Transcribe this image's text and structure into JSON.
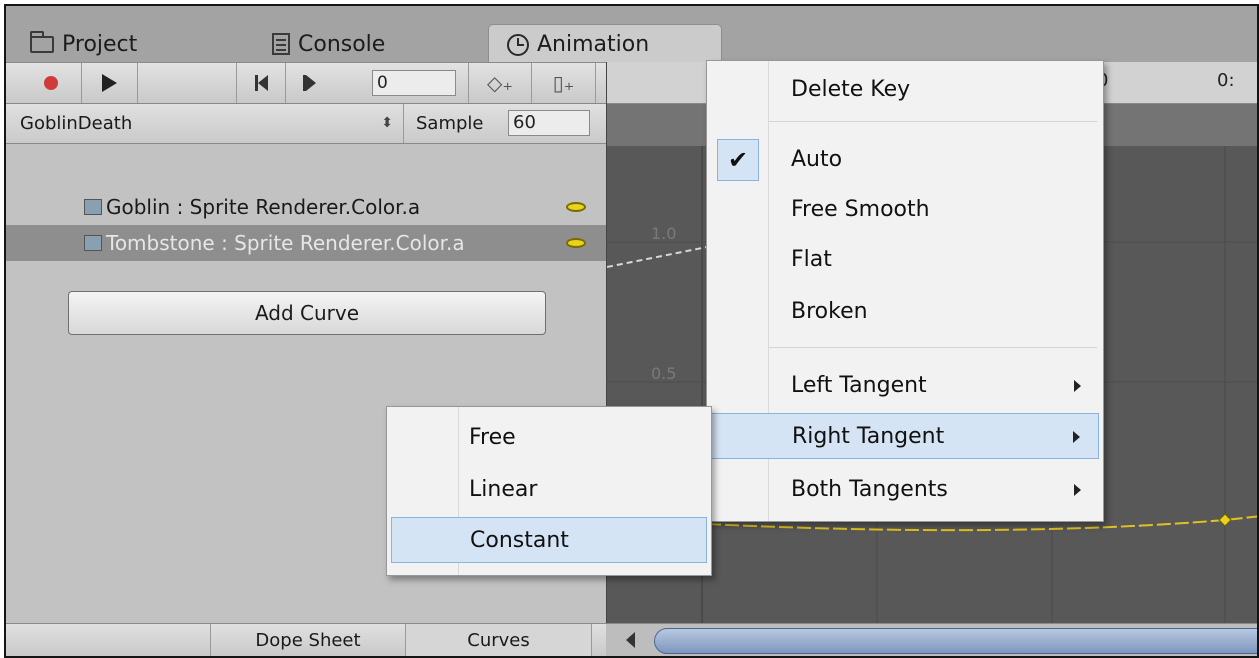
{
  "tabs": {
    "project": "Project",
    "console": "Console",
    "animation": "Animation"
  },
  "toolbar": {
    "frame_value": "0",
    "icons": [
      "record-icon",
      "play-icon",
      "prev-key-icon",
      "next-key-icon",
      "add-keyframe-icon",
      "add-event-icon"
    ]
  },
  "clip": {
    "name": "GoblinDeath",
    "sample_label": "Sample",
    "sample_value": "60"
  },
  "properties": [
    {
      "label": "Goblin : Sprite Renderer.Color.a"
    },
    {
      "label": "Tombstone : Sprite Renderer.Color.a"
    }
  ],
  "add_curve_label": "Add Curve",
  "bottom_tabs": {
    "dope_sheet": "Dope Sheet",
    "curves": "Curves"
  },
  "curve_view": {
    "time_labels": [
      "0",
      "0:"
    ],
    "y_labels": [
      "1.0",
      "0.5"
    ],
    "curve_color": "#e0c220"
  },
  "context_menu": {
    "delete_key": "Delete Key",
    "auto": "Auto",
    "auto_checked": true,
    "free_smooth": "Free Smooth",
    "flat": "Flat",
    "broken": "Broken",
    "left_tangent": "Left Tangent",
    "right_tangent": "Right Tangent",
    "both_tangents": "Both Tangents",
    "highlighted": "Right Tangent"
  },
  "submenu": {
    "free": "Free",
    "linear": "Linear",
    "constant": "Constant",
    "highlighted": "Constant"
  },
  "colors": {
    "panel_bg": "#c2c2c2",
    "curve_bg": "#585858",
    "menu_highlight": "#d5e4f4",
    "record_red": "#cf3a3a",
    "scroll_thumb": "#7e96be"
  }
}
